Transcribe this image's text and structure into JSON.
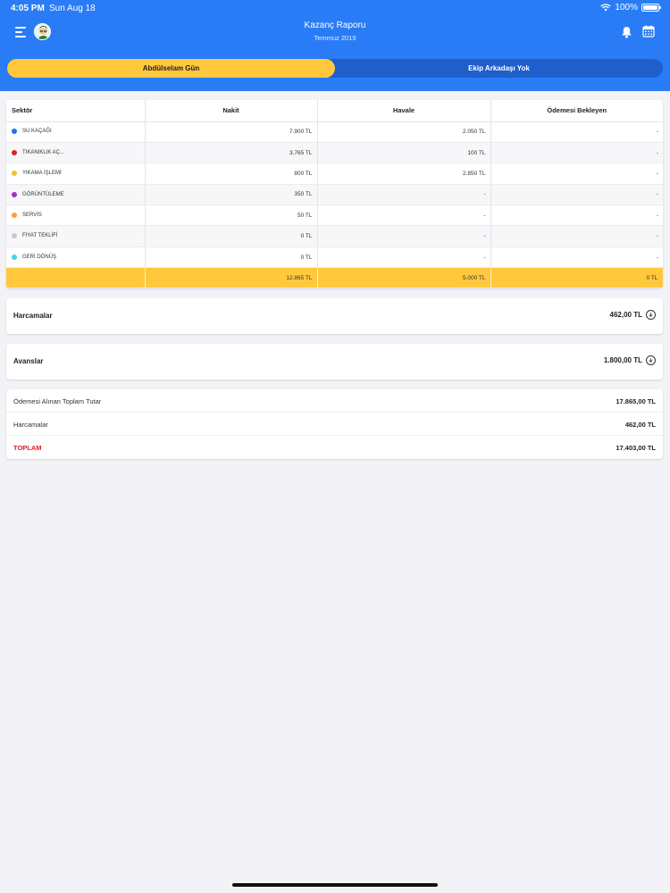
{
  "status_bar": {
    "time": "4:05 PM",
    "date": "Sun Aug 18",
    "battery": "100%"
  },
  "nav": {
    "title": "Kazanç Raporu",
    "subtitle": "Temmuz 2019"
  },
  "segment": {
    "active": "Abdülselam Gün",
    "inactive": "Ekip Arkadaşı Yok"
  },
  "table": {
    "headers": [
      "Sektör",
      "Nakit",
      "Havale",
      "Ödemesi Bekleyen"
    ],
    "rows": [
      {
        "sector": "SU KAÇAĞI",
        "color": "#1a73e8",
        "nakit": "7.900 TL",
        "havale": "2.050 TL",
        "bekleyen": "-"
      },
      {
        "sector": "TIKANIKLIK AÇ...",
        "color": "#e02020",
        "nakit": "3.765 TL",
        "havale": "100 TL",
        "bekleyen": "-"
      },
      {
        "sector": "YIKAMA İŞLEMİ",
        "color": "#f2c230",
        "nakit": "800 TL",
        "havale": "2.850 TL",
        "bekleyen": "-"
      },
      {
        "sector": "GÖRÜNTÜLEME",
        "color": "#a42ec2",
        "nakit": "350 TL",
        "havale": "-",
        "bekleyen": "-"
      },
      {
        "sector": "SERVİS",
        "color": "#f5a030",
        "nakit": "50 TL",
        "havale": "-",
        "bekleyen": "-"
      },
      {
        "sector": "FİYAT TEKLİFİ",
        "color": "#c8c8c8",
        "nakit": "0 TL",
        "havale": "-",
        "bekleyen": "-"
      },
      {
        "sector": "GERİ DÖNÜŞ",
        "color": "#3fd8e0",
        "nakit": "0 TL",
        "havale": "-",
        "bekleyen": "-"
      }
    ],
    "totals": {
      "nakit": "12.865 TL",
      "havale": "5.000 TL",
      "bekleyen": "0 TL"
    }
  },
  "expenses": {
    "label": "Harcamalar",
    "value": "462,00 TL"
  },
  "advances": {
    "label": "Avanslar",
    "value": "1.800,00 TL"
  },
  "summary": {
    "received_label": "Ödemesi Alınan Toplam Tutar",
    "received_value": "17.865,00 TL",
    "expenses_label": "Harcamalar",
    "expenses_value": "462,00 TL",
    "total_label": "TOPLAM",
    "total_value": "17.403,00 TL"
  },
  "colors": {
    "header_blue": "#2a7cf6",
    "segment_dark": "#1e5fcc",
    "accent_yellow": "#ffc83d",
    "total_red": "#e01b24"
  }
}
